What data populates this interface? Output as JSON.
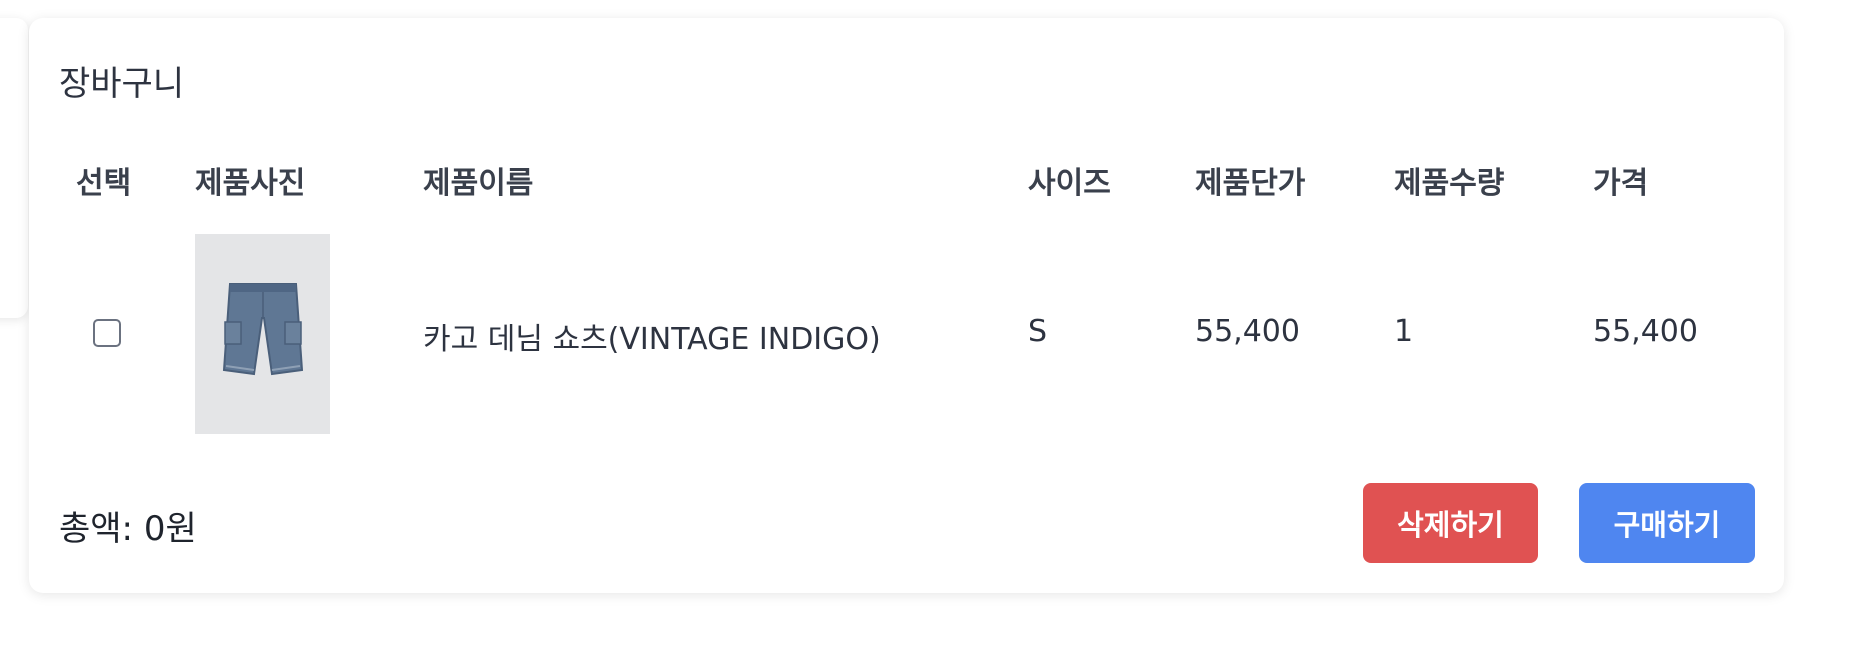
{
  "cart": {
    "title": "장바구니",
    "headers": {
      "select": "선택",
      "image": "제품사진",
      "name": "제품이름",
      "size": "사이즈",
      "unit_price": "제품단가",
      "quantity": "제품수량",
      "price": "가격"
    },
    "items": [
      {
        "selected": false,
        "name": "카고 데님 쇼츠(VINTAGE INDIGO)",
        "size": "S",
        "unit_price": "55,400",
        "quantity": "1",
        "price": "55,400"
      }
    ],
    "total_label": "총액: 0원",
    "buttons": {
      "delete": "삭제하기",
      "buy": "구매하기"
    }
  },
  "colors": {
    "delete_button": "#e05252",
    "buy_button": "#4f86f0",
    "text": "#2d3340"
  }
}
